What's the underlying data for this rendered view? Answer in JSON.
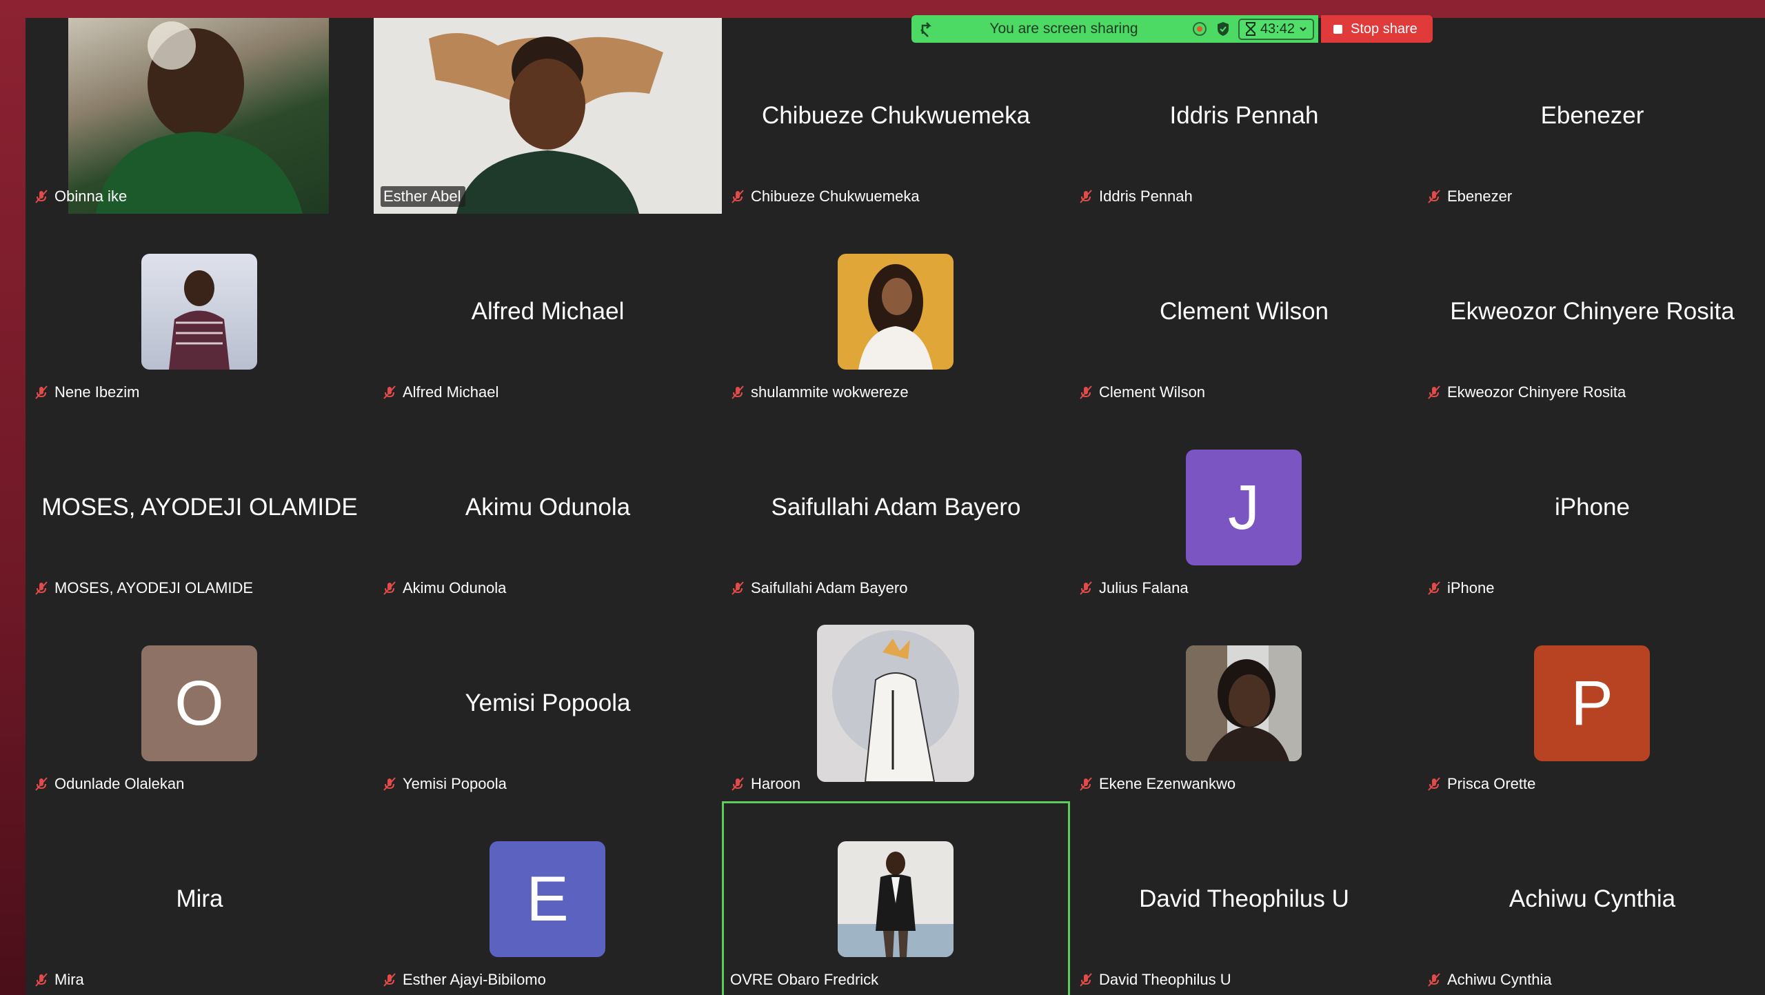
{
  "share_bar": {
    "status_text": "You are screen sharing",
    "timer": "43:42",
    "stop_label": "Stop share"
  },
  "participants": [
    {
      "label": "Obinna ike",
      "big_name": "",
      "kind": "video"
    },
    {
      "label": "Esther Abel",
      "big_name": "",
      "kind": "video"
    },
    {
      "label": "Chibueze Chukwuemeka",
      "big_name": "Chibueze Chukwuemeka",
      "kind": "name"
    },
    {
      "label": "Iddris Pennah",
      "big_name": "Iddris Pennah",
      "kind": "name"
    },
    {
      "label": "Ebenezer",
      "big_name": "Ebenezer",
      "kind": "name"
    },
    {
      "label": "Nene Ibezim",
      "big_name": "",
      "kind": "photo"
    },
    {
      "label": "Alfred Michael",
      "big_name": "Alfred Michael",
      "kind": "name"
    },
    {
      "label": "shulammite wokwereze",
      "big_name": "",
      "kind": "photo"
    },
    {
      "label": "Clement Wilson",
      "big_name": "Clement Wilson",
      "kind": "name"
    },
    {
      "label": "Ekweozor Chinyere Rosita",
      "big_name": "Ekweozor Chinyere Rosita",
      "kind": "name"
    },
    {
      "label": "MOSES, AYODEJI OLAMIDE",
      "big_name": "MOSES, AYODEJI OLAMIDE",
      "kind": "name"
    },
    {
      "label": "Akimu Odunola",
      "big_name": "Akimu Odunola",
      "kind": "name"
    },
    {
      "label": "Saifullahi Adam Bayero",
      "big_name": "Saifullahi Adam Bayero",
      "kind": "name"
    },
    {
      "label": "Julius Falana",
      "big_name": "",
      "kind": "letter",
      "letter": "J",
      "color": "#7b55c2"
    },
    {
      "label": "iPhone",
      "big_name": "iPhone",
      "kind": "name"
    },
    {
      "label": "Odunlade Olalekan",
      "big_name": "",
      "kind": "letter",
      "letter": "O",
      "color": "#8e7265"
    },
    {
      "label": "Yemisi Popoola",
      "big_name": "Yemisi Popoola",
      "kind": "name"
    },
    {
      "label": "Haroon",
      "big_name": "",
      "kind": "photo"
    },
    {
      "label": "Ekene Ezenwankwo",
      "big_name": "",
      "kind": "photo"
    },
    {
      "label": "Prisca Orette",
      "big_name": "",
      "kind": "letter",
      "letter": "P",
      "color": "#b84322"
    },
    {
      "label": "Mira",
      "big_name": "Mira",
      "kind": "name"
    },
    {
      "label": "Esther Ajayi-Bibilomo",
      "big_name": "",
      "kind": "letter",
      "letter": "E",
      "color": "#5c62c0"
    },
    {
      "label": "OVRE Obaro Fredrick",
      "big_name": "",
      "kind": "photo",
      "active": true
    },
    {
      "label": "David Theophilus U",
      "big_name": "David Theophilus U",
      "kind": "name"
    },
    {
      "label": "Achiwu Cynthia",
      "big_name": "Achiwu Cynthia",
      "kind": "name"
    }
  ]
}
